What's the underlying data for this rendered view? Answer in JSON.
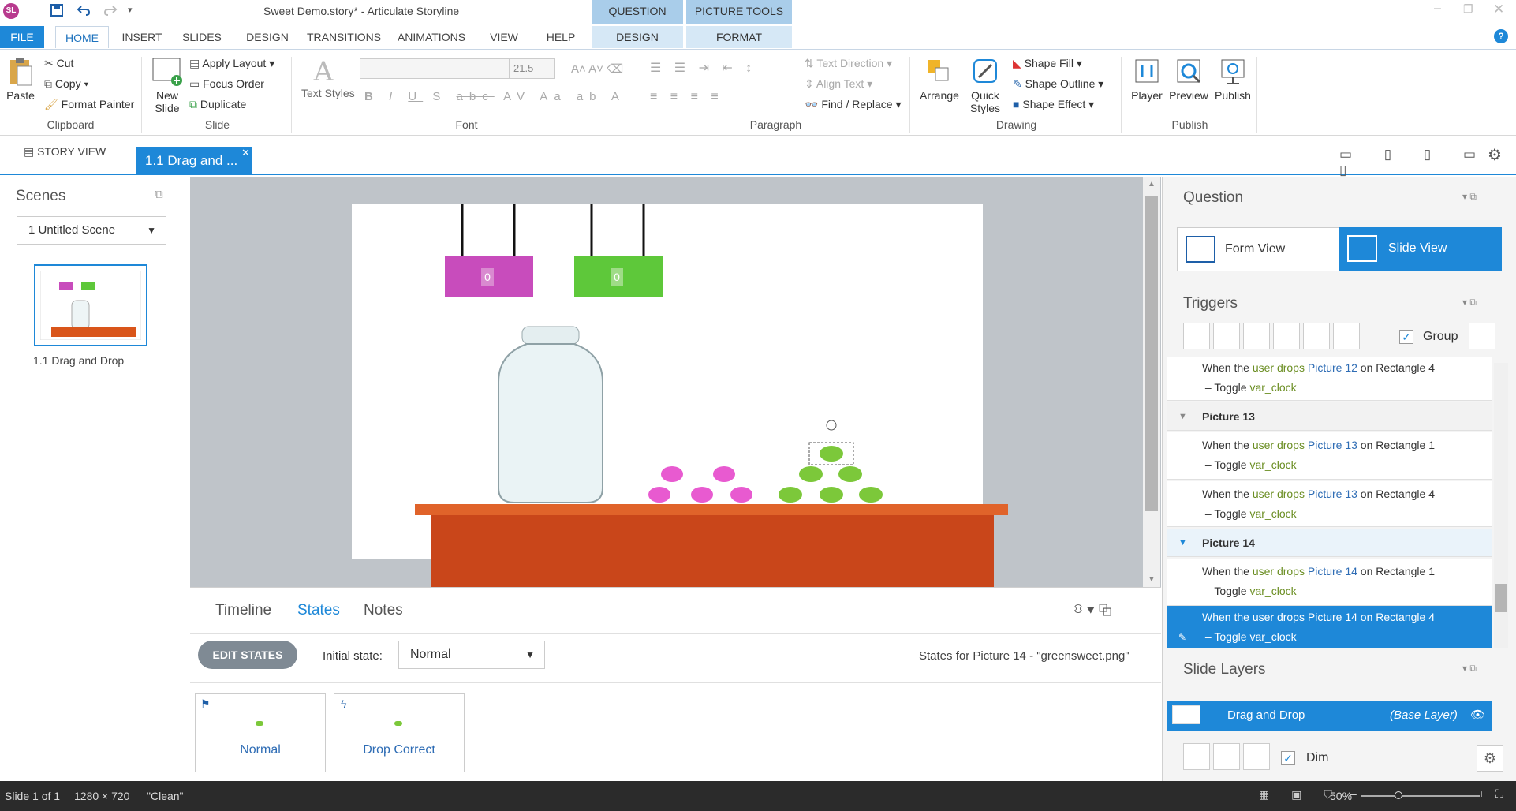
{
  "window": {
    "title": "Sweet Demo.story* -  Articulate Storyline",
    "context_tabs": [
      "QUESTION TOOLS",
      "PICTURE TOOLS"
    ],
    "context_subtabs": [
      "DESIGN",
      "FORMAT"
    ]
  },
  "menu": {
    "tabs": [
      "FILE",
      "HOME",
      "INSERT",
      "SLIDES",
      "DESIGN",
      "TRANSITIONS",
      "ANIMATIONS",
      "VIEW",
      "HELP"
    ]
  },
  "ribbon": {
    "clipboard": {
      "label": "Clipboard",
      "paste": "Paste",
      "cut": "Cut",
      "copy": "Copy",
      "format_painter": "Format Painter"
    },
    "slide": {
      "label": "Slide",
      "new_slide": "New Slide",
      "apply_layout": "Apply Layout",
      "focus_order": "Focus Order",
      "duplicate": "Duplicate"
    },
    "font": {
      "label": "Font",
      "text_styles": "Text Styles",
      "size": "21.5",
      "font_name": ""
    },
    "paragraph": {
      "label": "Paragraph",
      "text_direction": "Text Direction",
      "align_text": "Align Text",
      "find_replace": "Find / Replace"
    },
    "drawing": {
      "label": "Drawing",
      "arrange": "Arrange",
      "quick_styles": "Quick Styles",
      "shape_fill": "Shape Fill",
      "shape_outline": "Shape Outline",
      "shape_effect": "Shape Effect"
    },
    "publish": {
      "label": "Publish",
      "player": "Player",
      "preview": "Preview",
      "publish": "Publish"
    }
  },
  "viewbar": {
    "story_view": "STORY VIEW",
    "slide_tab": "1.1 Drag and ..."
  },
  "scenes": {
    "title": "Scenes",
    "selected": "1 Untitled Scene",
    "thumb_label": "1.1 Drag and Drop"
  },
  "slide": {
    "counter_left": "0",
    "counter_right": "0",
    "colors": {
      "magenta": "#c84cbc",
      "green": "#5ec83a",
      "shelf": "#d9551a"
    }
  },
  "timeline": {
    "tabs": [
      "Timeline",
      "States",
      "Notes"
    ],
    "edit_states": "EDIT STATES",
    "initial_state_label": "Initial state:",
    "initial_state_value": "Normal",
    "states_for": "States for Picture 14 - \"greensweet.png\"",
    "states": [
      "Normal",
      "Drop Correct"
    ]
  },
  "question": {
    "title": "Question",
    "form_view": "Form View",
    "slide_view": "Slide View"
  },
  "triggers": {
    "title": "Triggers",
    "group_label": "Group",
    "items": [
      {
        "pre": "When the ",
        "user": "user drops",
        "pic": "Picture 12",
        "on": " on Rectangle 4",
        "action": "Toggle",
        "var": "var_clock"
      },
      {
        "header": "Picture 13"
      },
      {
        "pre": "When the ",
        "user": "user drops",
        "pic": "Picture 13",
        "on": " on Rectangle 1",
        "action": "Toggle",
        "var": "var_clock"
      },
      {
        "pre": "When the ",
        "user": "user drops",
        "pic": "Picture 13",
        "on": " on Rectangle 4",
        "action": "Toggle",
        "var": "var_clock"
      },
      {
        "header": "Picture 14"
      },
      {
        "pre": "When the ",
        "user": "user drops",
        "pic": "Picture 14",
        "on": " on Rectangle 1",
        "action": "Toggle",
        "var": "var_clock"
      },
      {
        "pre": "When the ",
        "user": "user drops",
        "pic": "Picture 14",
        "on": " on Rectangle 4",
        "action": "Toggle",
        "var": "var_clock"
      }
    ]
  },
  "layers": {
    "title": "Slide Layers",
    "base_name": "Drag and Drop",
    "base_tag": "(Base Layer)",
    "dim_label": "Dim"
  },
  "status": {
    "slide": "Slide 1 of 1",
    "size": "1280 × 720",
    "theme": "\"Clean\"",
    "zoom": "50%"
  },
  "accent": "#1e88d8"
}
